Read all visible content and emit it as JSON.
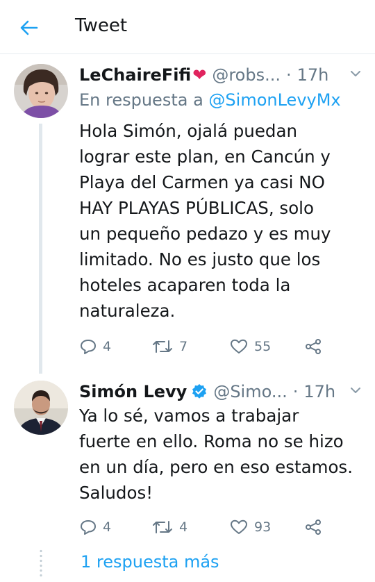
{
  "header": {
    "title": "Tweet"
  },
  "tweets": [
    {
      "name": "LeChaireFifi",
      "handle": "@robs...",
      "separator": "·",
      "time": "17h",
      "reply_prefix": "En respuesta a",
      "reply_mention": "@SimonLevyMx",
      "text_lines": [
        "Hola Simón, ojalá puedan",
        "lograr este plan, en Cancún y",
        "Playa del Carmen ya casi NO",
        "HAY PLAYAS PÚBLICAS, solo",
        "un pequeño pedazo y es muy",
        "limitado. No es justo que los",
        "hoteles acaparen toda la",
        "naturaleza."
      ],
      "replies": "4",
      "retweets": "7",
      "likes": "55"
    },
    {
      "name": "Simón Levy",
      "handle": "@Simo...",
      "separator": "·",
      "time": "17h",
      "text_lines": [
        "Ya lo sé, vamos a trabajar",
        "fuerte en ello. Roma no se hizo",
        "en un día, pero en eso estamos.",
        "Saludos!"
      ],
      "replies": "4",
      "retweets": "4",
      "likes": "93"
    }
  ],
  "more_replies": "1 respuesta más",
  "colors": {
    "accent": "#1da1f2",
    "muted": "#657786",
    "text": "#14171a",
    "heart": "#e0245e"
  }
}
